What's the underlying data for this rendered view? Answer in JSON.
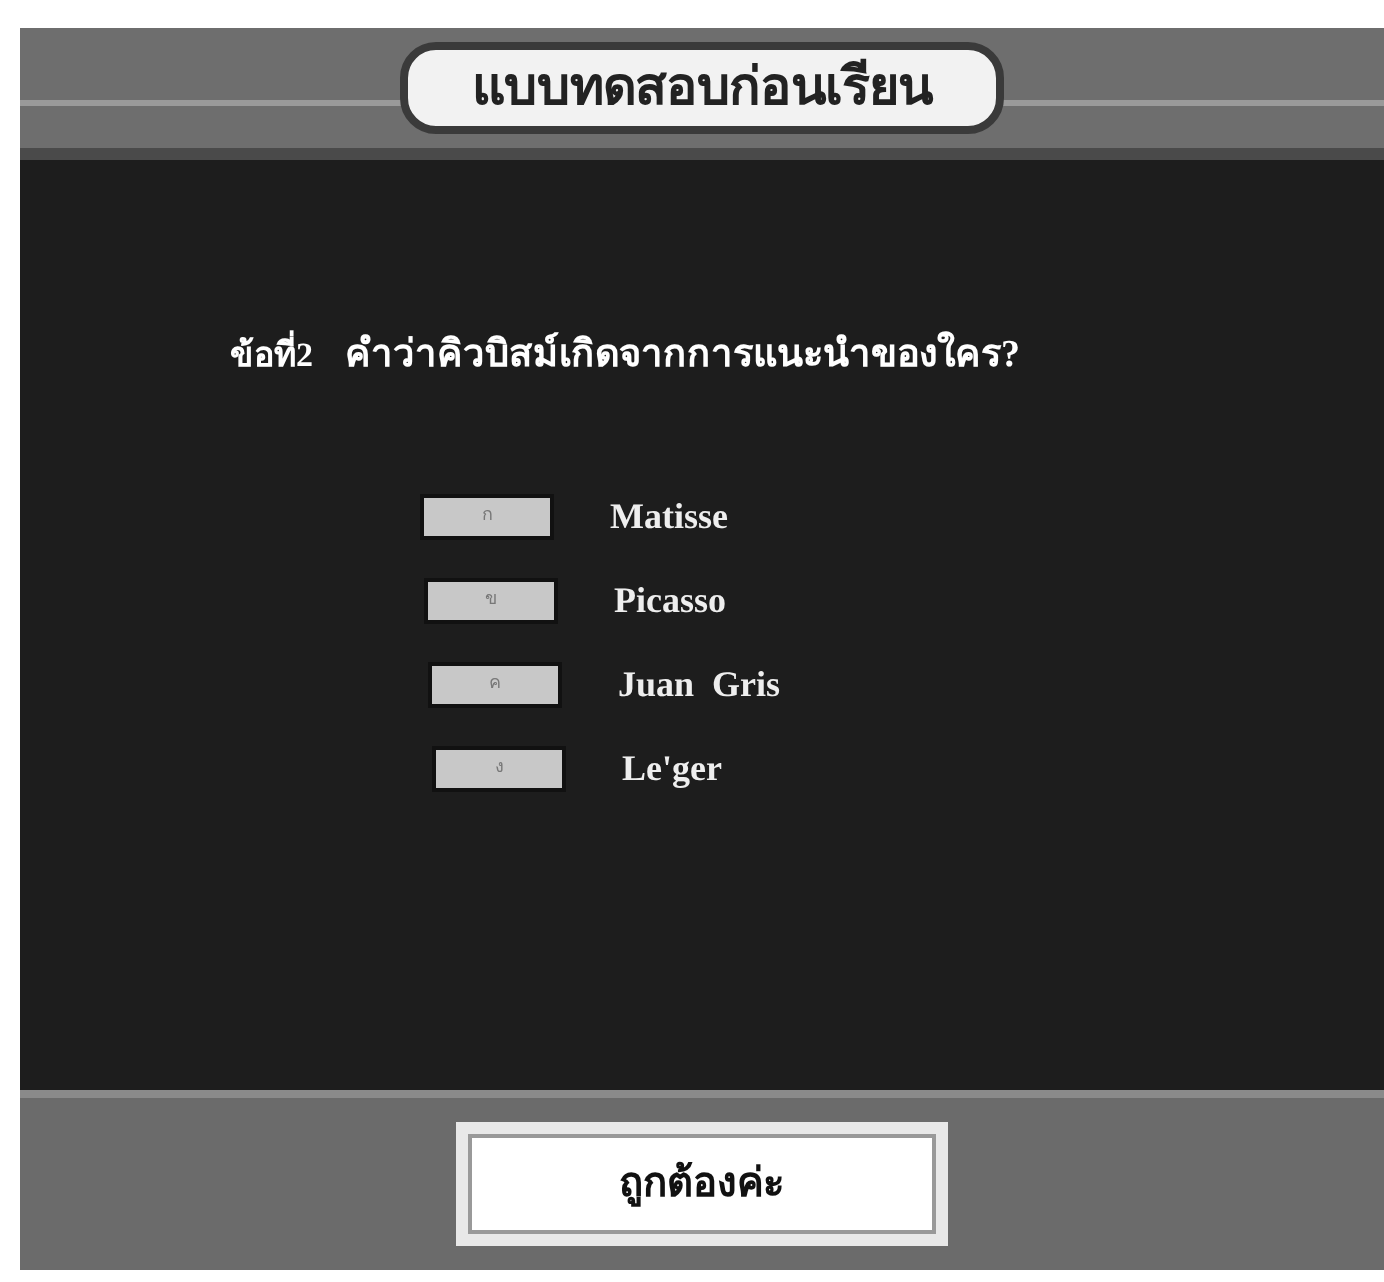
{
  "header": {
    "title": "แบบทดสอบก่อนเรียน"
  },
  "question": {
    "number": "ข้อที่2",
    "text": "คำว่าคิวบิสม์เกิดจากการแนะนำของใคร?"
  },
  "choices": [
    {
      "key": "ก",
      "label": "Matisse"
    },
    {
      "key": "ข",
      "label": "Picasso"
    },
    {
      "key": "ค",
      "label": "Juan  Gris"
    },
    {
      "key": "ง",
      "label": "Le'ger"
    }
  ],
  "feedback": {
    "text": "ถูกต้องค่ะ"
  }
}
